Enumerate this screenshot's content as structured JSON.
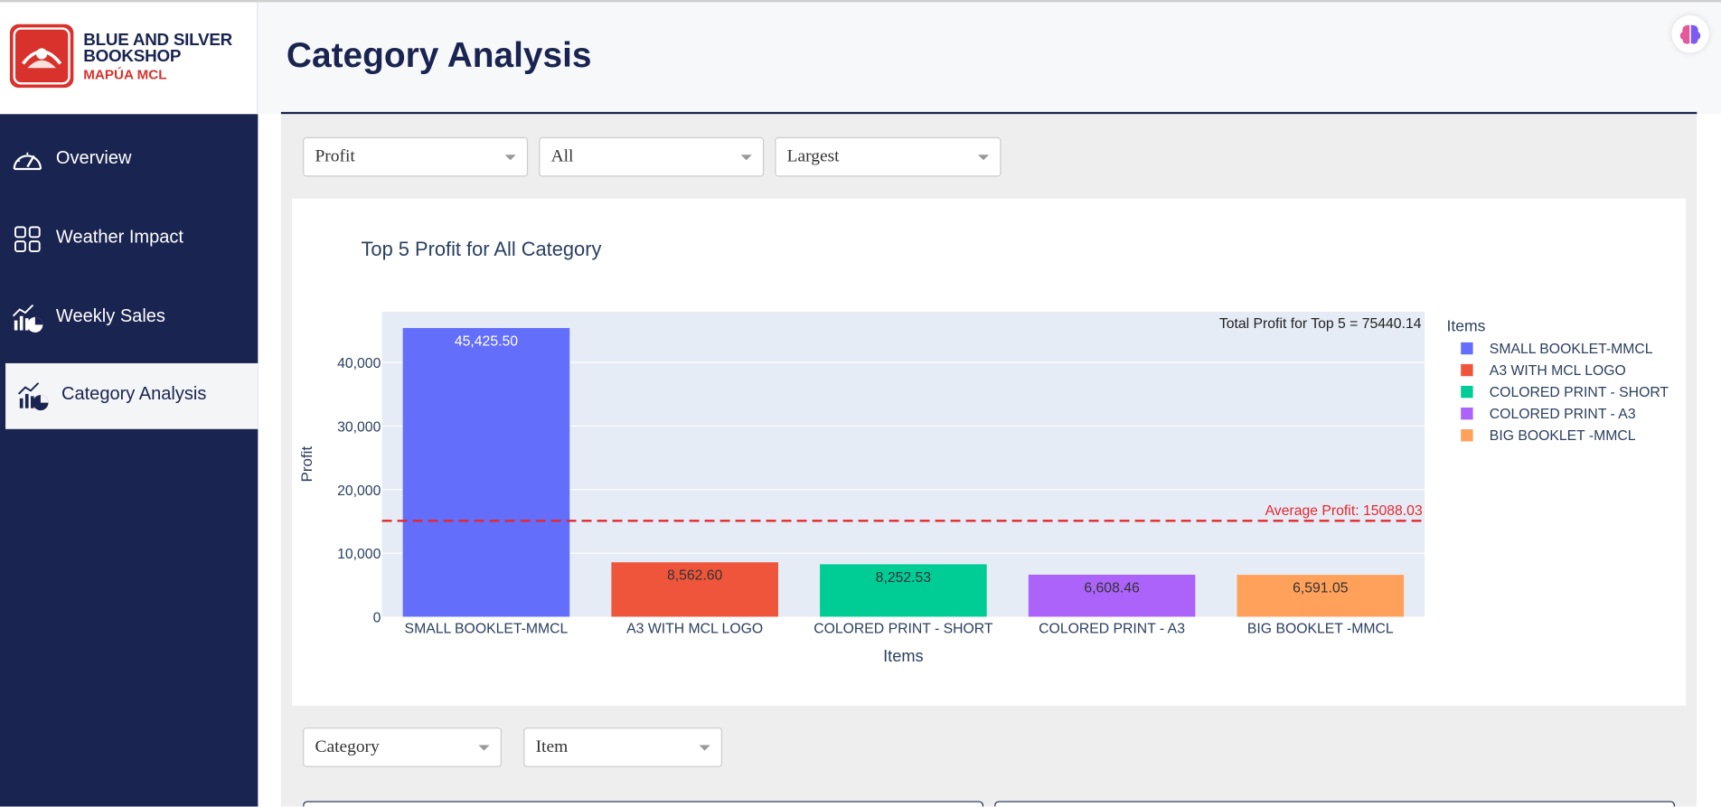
{
  "brand": {
    "line1": "BLUE AND SILVER",
    "line2": "BOOKSHOP",
    "line3": "MAPÚA MCL"
  },
  "nav": {
    "items": [
      {
        "label": "Overview",
        "icon": "speedometer-icon"
      },
      {
        "label": "Weather Impact",
        "icon": "grid-icon"
      },
      {
        "label": "Weekly Sales",
        "icon": "chart-pie-icon"
      },
      {
        "label": "Category Analysis",
        "icon": "chart-pie-icon"
      }
    ],
    "active": "Category Analysis"
  },
  "header": {
    "title": "Category Analysis",
    "assistant_icon": "brain-icon"
  },
  "filters": {
    "metric": "Profit",
    "category": "All",
    "order": "Largest"
  },
  "bottom_filters": {
    "group": "Category",
    "level": "Item"
  },
  "colors": {
    "sidebar": "#1a2450",
    "accent_red": "#d9322d",
    "plot_bg": "#e5ecf6",
    "avg_line": "#e5282e"
  },
  "chart_data": {
    "type": "bar",
    "title": "Top 5 Profit for All Category",
    "xlabel": "Items",
    "ylabel": "Profit",
    "ylim": [
      0,
      48000
    ],
    "yticks": [
      0,
      10000,
      20000,
      30000,
      40000
    ],
    "ytick_labels": [
      "0",
      "10,000",
      "20,000",
      "30,000",
      "40,000"
    ],
    "categories": [
      "SMALL BOOKLET-MMCL",
      "A3 WITH MCL LOGO",
      "COLORED PRINT - SHORT",
      "COLORED PRINT - A3",
      "BIG BOOKLET -MMCL"
    ],
    "values": [
      45425.5,
      8562.6,
      8252.53,
      6608.46,
      6591.05
    ],
    "value_labels": [
      "45,425.50",
      "8,562.60",
      "8,252.53",
      "6,608.46",
      "6,591.05"
    ],
    "colors": [
      "#636efa",
      "#ef553b",
      "#00cc96",
      "#ab63fa",
      "#ffa15a"
    ],
    "legend_title": "Items",
    "legend_position": "right",
    "average": 15088.03,
    "average_label": "Average Profit: 15088.03",
    "total_label": "Total Profit for Top 5 = 75440.14",
    "grid": true
  }
}
